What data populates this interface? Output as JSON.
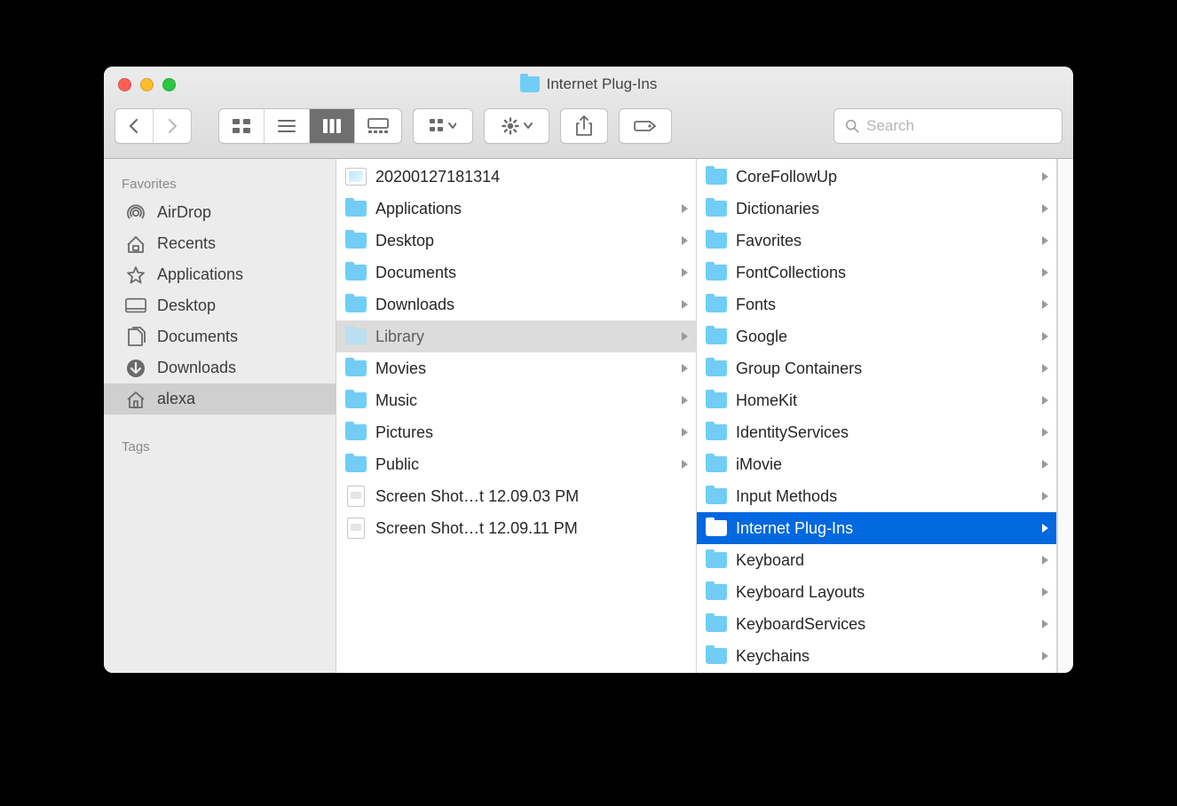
{
  "window": {
    "title": "Internet Plug-Ins"
  },
  "toolbar": {
    "search_placeholder": "Search"
  },
  "sidebar": {
    "favorites_label": "Favorites",
    "tags_label": "Tags",
    "items": [
      {
        "label": "AirDrop",
        "icon": "airdrop"
      },
      {
        "label": "Recents",
        "icon": "recents"
      },
      {
        "label": "Applications",
        "icon": "applications"
      },
      {
        "label": "Desktop",
        "icon": "desktop"
      },
      {
        "label": "Documents",
        "icon": "documents"
      },
      {
        "label": "Downloads",
        "icon": "downloads"
      },
      {
        "label": "alexa",
        "icon": "home",
        "selected": true
      }
    ]
  },
  "columns": {
    "col1": [
      {
        "name": "20200127181314",
        "type": "image"
      },
      {
        "name": "Applications",
        "type": "folder",
        "has_children": true
      },
      {
        "name": "Desktop",
        "type": "folder",
        "has_children": true
      },
      {
        "name": "Documents",
        "type": "folder",
        "has_children": true
      },
      {
        "name": "Downloads",
        "type": "folder",
        "has_children": true
      },
      {
        "name": "Library",
        "type": "folder",
        "has_children": true,
        "state": "inactive-selected"
      },
      {
        "name": "Movies",
        "type": "folder",
        "has_children": true
      },
      {
        "name": "Music",
        "type": "folder",
        "has_children": true
      },
      {
        "name": "Pictures",
        "type": "folder",
        "has_children": true
      },
      {
        "name": "Public",
        "type": "folder",
        "has_children": true
      },
      {
        "name": "Screen Shot…t 12.09.03 PM",
        "type": "file"
      },
      {
        "name": "Screen Shot…t 12.09.11 PM",
        "type": "file"
      }
    ],
    "col2": [
      {
        "name": "CoreFollowUp",
        "type": "folder",
        "has_children": true
      },
      {
        "name": "Dictionaries",
        "type": "folder",
        "has_children": true
      },
      {
        "name": "Favorites",
        "type": "folder",
        "has_children": true
      },
      {
        "name": "FontCollections",
        "type": "folder",
        "has_children": true
      },
      {
        "name": "Fonts",
        "type": "folder",
        "has_children": true
      },
      {
        "name": "Google",
        "type": "folder",
        "has_children": true
      },
      {
        "name": "Group Containers",
        "type": "folder",
        "has_children": true
      },
      {
        "name": "HomeKit",
        "type": "folder",
        "has_children": true
      },
      {
        "name": "IdentityServices",
        "type": "folder",
        "has_children": true
      },
      {
        "name": "iMovie",
        "type": "folder",
        "has_children": true
      },
      {
        "name": "Input Methods",
        "type": "folder",
        "has_children": true
      },
      {
        "name": "Internet Plug-Ins",
        "type": "folder",
        "has_children": true,
        "state": "selected"
      },
      {
        "name": "Keyboard",
        "type": "folder",
        "has_children": true
      },
      {
        "name": "Keyboard Layouts",
        "type": "folder",
        "has_children": true
      },
      {
        "name": "KeyboardServices",
        "type": "folder",
        "has_children": true
      },
      {
        "name": "Keychains",
        "type": "folder",
        "has_children": true
      }
    ]
  }
}
